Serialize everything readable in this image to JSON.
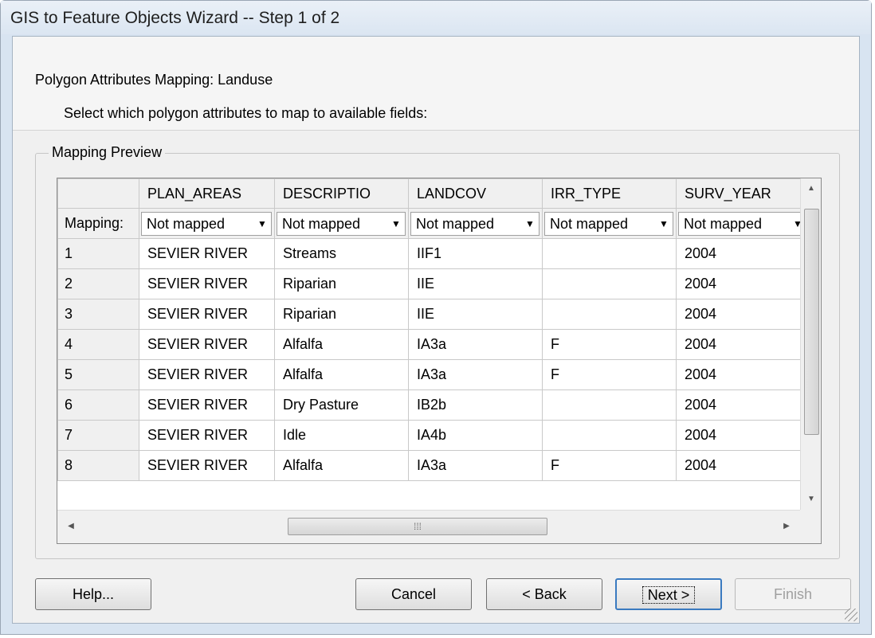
{
  "window": {
    "title": "GIS to Feature Objects Wizard -- Step 1 of 2"
  },
  "header": {
    "title": "Polygon Attributes Mapping:  Landuse",
    "subtitle": "Select which polygon attributes to map to available fields:"
  },
  "group": {
    "label": "Mapping Preview"
  },
  "grid": {
    "columns": [
      "PLAN_AREAS",
      "DESCRIPTIO",
      "LANDCOV",
      "IRR_TYPE",
      "SURV_YEAR"
    ],
    "mapping_label": "Mapping:",
    "mapping_values": [
      "Not mapped",
      "Not mapped",
      "Not mapped",
      "Not mapped",
      "Not mapped"
    ],
    "rows": [
      [
        "1",
        "SEVIER RIVER",
        "Streams",
        "IIF1",
        "",
        "2004"
      ],
      [
        "2",
        "SEVIER RIVER",
        "Riparian",
        "IIE",
        "",
        "2004"
      ],
      [
        "3",
        "SEVIER RIVER",
        "Riparian",
        "IIE",
        "",
        "2004"
      ],
      [
        "4",
        "SEVIER RIVER",
        "Alfalfa",
        "IA3a",
        "F",
        "2004"
      ],
      [
        "5",
        "SEVIER RIVER",
        "Alfalfa",
        "IA3a",
        "F",
        "2004"
      ],
      [
        "6",
        "SEVIER RIVER",
        "Dry Pasture",
        "IB2b",
        "",
        "2004"
      ],
      [
        "7",
        "SEVIER RIVER",
        "Idle",
        "IA4b",
        "",
        "2004"
      ],
      [
        "8",
        "SEVIER RIVER",
        "Alfalfa",
        "IA3a",
        "F",
        "2004"
      ]
    ]
  },
  "buttons": {
    "help": "Help...",
    "cancel": "Cancel",
    "back": "< Back",
    "next": "Next >",
    "finish": "Finish"
  }
}
